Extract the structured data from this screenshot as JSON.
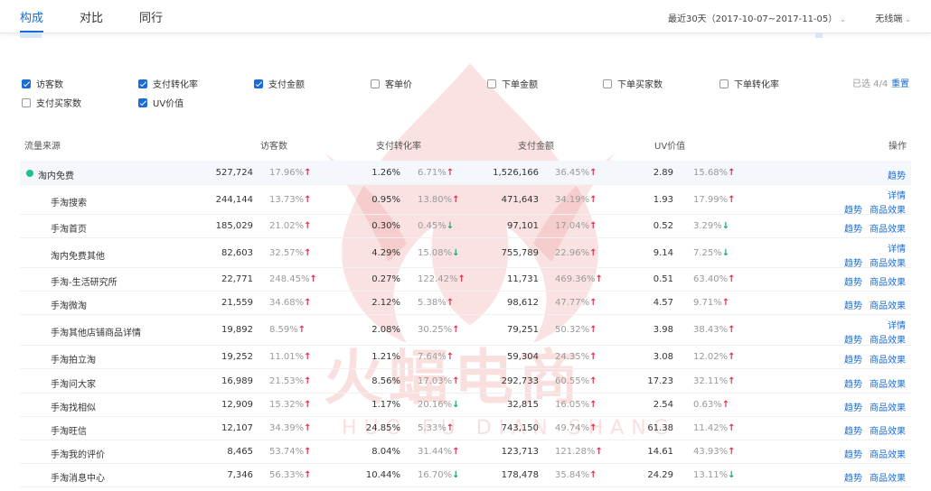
{
  "tabs": [
    {
      "label": "构成",
      "active": true
    },
    {
      "label": "对比",
      "active": false
    },
    {
      "label": "同行",
      "active": false
    }
  ],
  "date_range": "最近30天（2017-10-07~2017-11-05）",
  "network": "无线端",
  "metrics": [
    {
      "label": "访客数",
      "checked": true
    },
    {
      "label": "支付转化率",
      "checked": true
    },
    {
      "label": "支付金额",
      "checked": true
    },
    {
      "label": "客单价",
      "checked": false
    },
    {
      "label": "下单金额",
      "checked": false
    },
    {
      "label": "下单买家数",
      "checked": false
    },
    {
      "label": "下单转化率",
      "checked": false
    },
    {
      "label": "支付买家数",
      "checked": false
    },
    {
      "label": "UV价值",
      "checked": true
    }
  ],
  "selected_count": "已选 4/4",
  "reset_label": "重置",
  "columns": [
    "流量来源",
    "访客数",
    "支付转化率",
    "支付金额",
    "UV价值",
    "操作"
  ],
  "actions": {
    "trend": "趋势",
    "detail": "详情",
    "product": "商品效果"
  },
  "watermark": {
    "main": "火蝠电商",
    "sub": "HUO FU DIAN SHANG"
  },
  "rows": [
    {
      "source": "淘内免费",
      "level": 0,
      "visitors": "527,724",
      "visitors_chg": "17.96%",
      "visitors_dir": "up",
      "cvr": "1.26%",
      "cvr_chg": "6.71%",
      "cvr_dir": "up",
      "amount": "1,526,166",
      "amount_chg": "36.45%",
      "amount_dir": "up",
      "uv": "2.89",
      "uv_chg": "15.68%",
      "uv_dir": "up",
      "ops": [
        "trend"
      ]
    },
    {
      "source": "手淘搜索",
      "level": 1,
      "visitors": "244,144",
      "visitors_chg": "13.73%",
      "visitors_dir": "up",
      "cvr": "0.95%",
      "cvr_chg": "13.80%",
      "cvr_dir": "up",
      "amount": "471,643",
      "amount_chg": "34.19%",
      "amount_dir": "up",
      "uv": "1.93",
      "uv_chg": "17.99%",
      "uv_dir": "up",
      "ops": [
        "detail",
        "trend",
        "product"
      ]
    },
    {
      "source": "手淘首页",
      "level": 1,
      "visitors": "185,029",
      "visitors_chg": "21.02%",
      "visitors_dir": "up",
      "cvr": "0.30%",
      "cvr_chg": "0.45%",
      "cvr_dir": "down",
      "amount": "97,101",
      "amount_chg": "17.04%",
      "amount_dir": "up",
      "uv": "0.52",
      "uv_chg": "3.29%",
      "uv_dir": "down",
      "ops": [
        "trend",
        "product"
      ]
    },
    {
      "source": "淘内免费其他",
      "level": 1,
      "visitors": "82,603",
      "visitors_chg": "32.57%",
      "visitors_dir": "up",
      "cvr": "4.29%",
      "cvr_chg": "15.08%",
      "cvr_dir": "down",
      "amount": "755,789",
      "amount_chg": "22.96%",
      "amount_dir": "up",
      "uv": "9.14",
      "uv_chg": "7.25%",
      "uv_dir": "down",
      "ops": [
        "detail",
        "trend",
        "product"
      ]
    },
    {
      "source": "手淘-生活研究所",
      "level": 1,
      "visitors": "22,771",
      "visitors_chg": "248.45%",
      "visitors_dir": "up",
      "cvr": "0.27%",
      "cvr_chg": "122.42%",
      "cvr_dir": "up",
      "amount": "11,731",
      "amount_chg": "469.36%",
      "amount_dir": "up",
      "uv": "0.51",
      "uv_chg": "63.40%",
      "uv_dir": "up",
      "ops": [
        "trend",
        "product"
      ]
    },
    {
      "source": "手淘微淘",
      "level": 1,
      "visitors": "21,559",
      "visitors_chg": "34.68%",
      "visitors_dir": "up",
      "cvr": "2.12%",
      "cvr_chg": "5.38%",
      "cvr_dir": "up",
      "amount": "98,612",
      "amount_chg": "47.77%",
      "amount_dir": "up",
      "uv": "4.57",
      "uv_chg": "9.71%",
      "uv_dir": "up",
      "ops": [
        "trend",
        "product"
      ]
    },
    {
      "source": "手淘其他店铺商品详情",
      "level": 1,
      "visitors": "19,892",
      "visitors_chg": "8.59%",
      "visitors_dir": "up",
      "cvr": "2.08%",
      "cvr_chg": "30.25%",
      "cvr_dir": "up",
      "amount": "79,251",
      "amount_chg": "50.32%",
      "amount_dir": "up",
      "uv": "3.98",
      "uv_chg": "38.43%",
      "uv_dir": "up",
      "ops": [
        "detail",
        "trend",
        "product"
      ]
    },
    {
      "source": "手淘拍立淘",
      "level": 1,
      "visitors": "19,252",
      "visitors_chg": "11.01%",
      "visitors_dir": "up",
      "cvr": "1.21%",
      "cvr_chg": "7.64%",
      "cvr_dir": "up",
      "amount": "59,304",
      "amount_chg": "24.35%",
      "amount_dir": "up",
      "uv": "3.08",
      "uv_chg": "12.02%",
      "uv_dir": "up",
      "ops": [
        "trend",
        "product"
      ]
    },
    {
      "source": "手淘问大家",
      "level": 1,
      "visitors": "16,989",
      "visitors_chg": "21.53%",
      "visitors_dir": "up",
      "cvr": "8.56%",
      "cvr_chg": "17.03%",
      "cvr_dir": "up",
      "amount": "292,733",
      "amount_chg": "60.55%",
      "amount_dir": "up",
      "uv": "17.23",
      "uv_chg": "32.11%",
      "uv_dir": "up",
      "ops": [
        "trend",
        "product"
      ]
    },
    {
      "source": "手淘找相似",
      "level": 1,
      "visitors": "12,909",
      "visitors_chg": "15.32%",
      "visitors_dir": "up",
      "cvr": "1.17%",
      "cvr_chg": "20.16%",
      "cvr_dir": "down",
      "amount": "32,815",
      "amount_chg": "16.05%",
      "amount_dir": "up",
      "uv": "2.54",
      "uv_chg": "0.63%",
      "uv_dir": "up",
      "ops": [
        "trend",
        "product"
      ]
    },
    {
      "source": "手淘旺信",
      "level": 1,
      "visitors": "12,107",
      "visitors_chg": "34.39%",
      "visitors_dir": "up",
      "cvr": "24.85%",
      "cvr_chg": "5.33%",
      "cvr_dir": "up",
      "amount": "743,150",
      "amount_chg": "49.74%",
      "amount_dir": "up",
      "uv": "61.38",
      "uv_chg": "11.42%",
      "uv_dir": "up",
      "ops": [
        "trend",
        "product"
      ]
    },
    {
      "source": "手淘我的评价",
      "level": 1,
      "visitors": "8,465",
      "visitors_chg": "53.74%",
      "visitors_dir": "up",
      "cvr": "8.04%",
      "cvr_chg": "31.44%",
      "cvr_dir": "up",
      "amount": "123,713",
      "amount_chg": "121.28%",
      "amount_dir": "up",
      "uv": "14.61",
      "uv_chg": "43.93%",
      "uv_dir": "up",
      "ops": [
        "trend",
        "product"
      ]
    },
    {
      "source": "手淘消息中心",
      "level": 1,
      "visitors": "7,346",
      "visitors_chg": "56.33%",
      "visitors_dir": "up",
      "cvr": "10.44%",
      "cvr_chg": "16.70%",
      "cvr_dir": "down",
      "amount": "178,478",
      "amount_chg": "35.84%",
      "amount_dir": "up",
      "uv": "24.29",
      "uv_chg": "13.11%",
      "uv_dir": "down",
      "ops": [
        "trend",
        "product"
      ]
    }
  ]
}
